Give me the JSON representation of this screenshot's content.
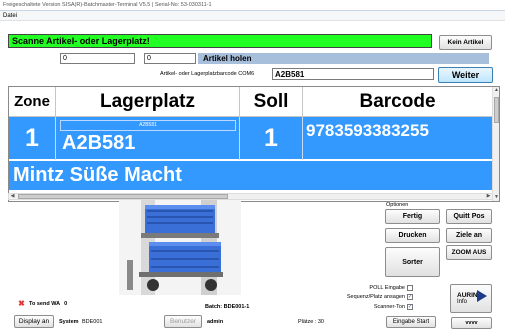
{
  "window": {
    "title": "Freigeschaltete Version SISA(R)-Batchmaster-Terminal V5.5 | Serial-No: 53-030311-1"
  },
  "menu": {
    "items": [
      "Datei"
    ]
  },
  "status": {
    "message": "Scanne Artikel- oder Lagerplatz!",
    "message_color": "#22ff22",
    "kein_artikel_label": "Kein Artikel"
  },
  "inputs": {
    "field1_value": "0",
    "field2_value": "0",
    "artikel_holen_label": "Artikel holen",
    "barcode_label": "Artikel- oder Lagerplatzbarcode COM6",
    "barcode_value": "A2B581",
    "weiter_label": "Weiter"
  },
  "table": {
    "headers": {
      "zone": "Zone",
      "lagerplatz": "Lagerplatz",
      "soll": "Soll",
      "barcode": "Barcode"
    },
    "row": {
      "zone": "1",
      "lagerplatz_small": "A2B581",
      "lagerplatz": "A2B581",
      "soll": "1",
      "barcode": "9783593383255",
      "artikel_name": "Mintz Süße Macht"
    },
    "highlight_color": "#3399ff"
  },
  "options": {
    "title": "Optionen",
    "fertig": "Fertig",
    "quitt_pos": "Quitt Pos",
    "drucken": "Drucken",
    "ziele_an": "Ziele an",
    "zoom_aus": "ZOOM AUS",
    "sorter": "Sorter",
    "poll_eingabe": "POLL Eingabe",
    "poll_checked": false,
    "sequenz_label": "Sequenz/Platz ansagen",
    "sequenz_checked": true,
    "scanner_ton": "Scanner-Ton",
    "scanner_checked": true,
    "aurin_line1": "AURIN",
    "aurin_line2": "Info",
    "eingabe_start": "Eingabe Start",
    "vvvv": "vvvv"
  },
  "footer": {
    "to_send_label": "To send WA",
    "to_send_count": "0",
    "batch": "Batch: BDE001-1",
    "display_an": "Display an",
    "system_label": "System",
    "system_value": "BDE001",
    "benutzer": "Benutzer",
    "user": "admin",
    "platze": "Plätze : 30"
  }
}
